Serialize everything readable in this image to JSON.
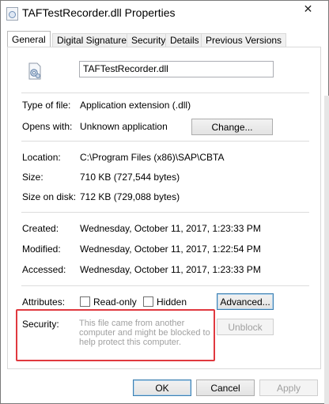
{
  "window": {
    "title": "TAFTestRecorder.dll Properties",
    "close_glyph": "✕"
  },
  "tabs": [
    {
      "label": "General",
      "active": true
    },
    {
      "label": "Digital Signatures",
      "active": false
    },
    {
      "label": "Security",
      "active": false
    },
    {
      "label": "Details",
      "active": false
    },
    {
      "label": "Previous Versions",
      "active": false
    }
  ],
  "general": {
    "filename": "TAFTestRecorder.dll",
    "type_label": "Type of file:",
    "type_value": "Application extension (.dll)",
    "opens_label": "Opens with:",
    "opens_value": "Unknown application",
    "change_button": "Change...",
    "location_label": "Location:",
    "location_value": "C:\\Program Files (x86)\\SAP\\CBTA",
    "size_label": "Size:",
    "size_value": "710 KB (727,544 bytes)",
    "disk_label": "Size on disk:",
    "disk_value": "712 KB (729,088 bytes)",
    "created_label": "Created:",
    "created_value": "Wednesday, October 11, 2017, 1:23:33 PM",
    "modified_label": "Modified:",
    "modified_value": "Wednesday, October 11, 2017, 1:22:54 PM",
    "accessed_label": "Accessed:",
    "accessed_value": "Wednesday, October 11, 2017, 1:23:33 PM",
    "attributes_label": "Attributes:",
    "readonly_label": "Read-only",
    "readonly_checked": false,
    "hidden_label": "Hidden",
    "hidden_checked": false,
    "advanced_button": "Advanced...",
    "security_label": "Security:",
    "security_note": "This file came from another computer and might be blocked to help protect this computer.",
    "unblock_button": "Unblock"
  },
  "footer": {
    "ok": "OK",
    "cancel": "Cancel",
    "apply": "Apply"
  },
  "colors": {
    "highlight_box": "#e0393f"
  }
}
